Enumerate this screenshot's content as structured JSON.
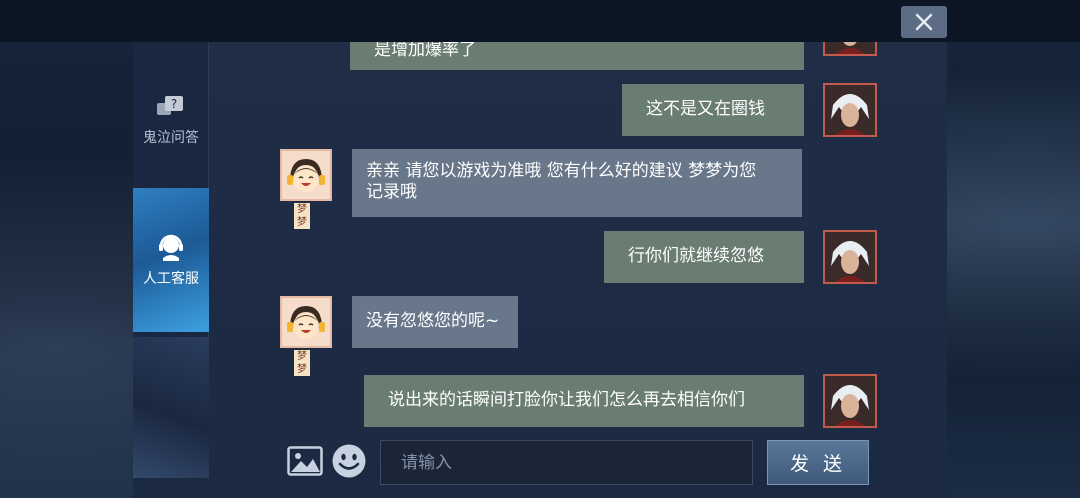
{
  "sidebar": {
    "tabs": [
      {
        "label": "鬼泣问答",
        "icon": "question-bubble-icon"
      },
      {
        "label": "人工客服",
        "icon": "headset-agent-icon",
        "active": true
      }
    ]
  },
  "agent": {
    "name": "梦梦"
  },
  "messages": [
    {
      "from": "user",
      "text": "是增加爆率了"
    },
    {
      "from": "user",
      "text": "这不是又在圈钱"
    },
    {
      "from": "agent",
      "lines": [
        "亲亲 请您以游戏为准哦 您有什么好的建议 梦梦为您",
        "记录哦"
      ]
    },
    {
      "from": "user",
      "text": "行你们就继续忽悠"
    },
    {
      "from": "agent",
      "lines": [
        "没有忽悠您的呢~"
      ]
    },
    {
      "from": "user",
      "text": "说出来的话瞬间打脸你让我们怎么再去相信你们"
    }
  ],
  "input": {
    "placeholder": "请输入",
    "value": ""
  },
  "send_label": "发 送",
  "colors": {
    "user_bubble": "#6a7d73",
    "agent_bubble": "#68778a",
    "active_tab": "#2f7fc1"
  }
}
